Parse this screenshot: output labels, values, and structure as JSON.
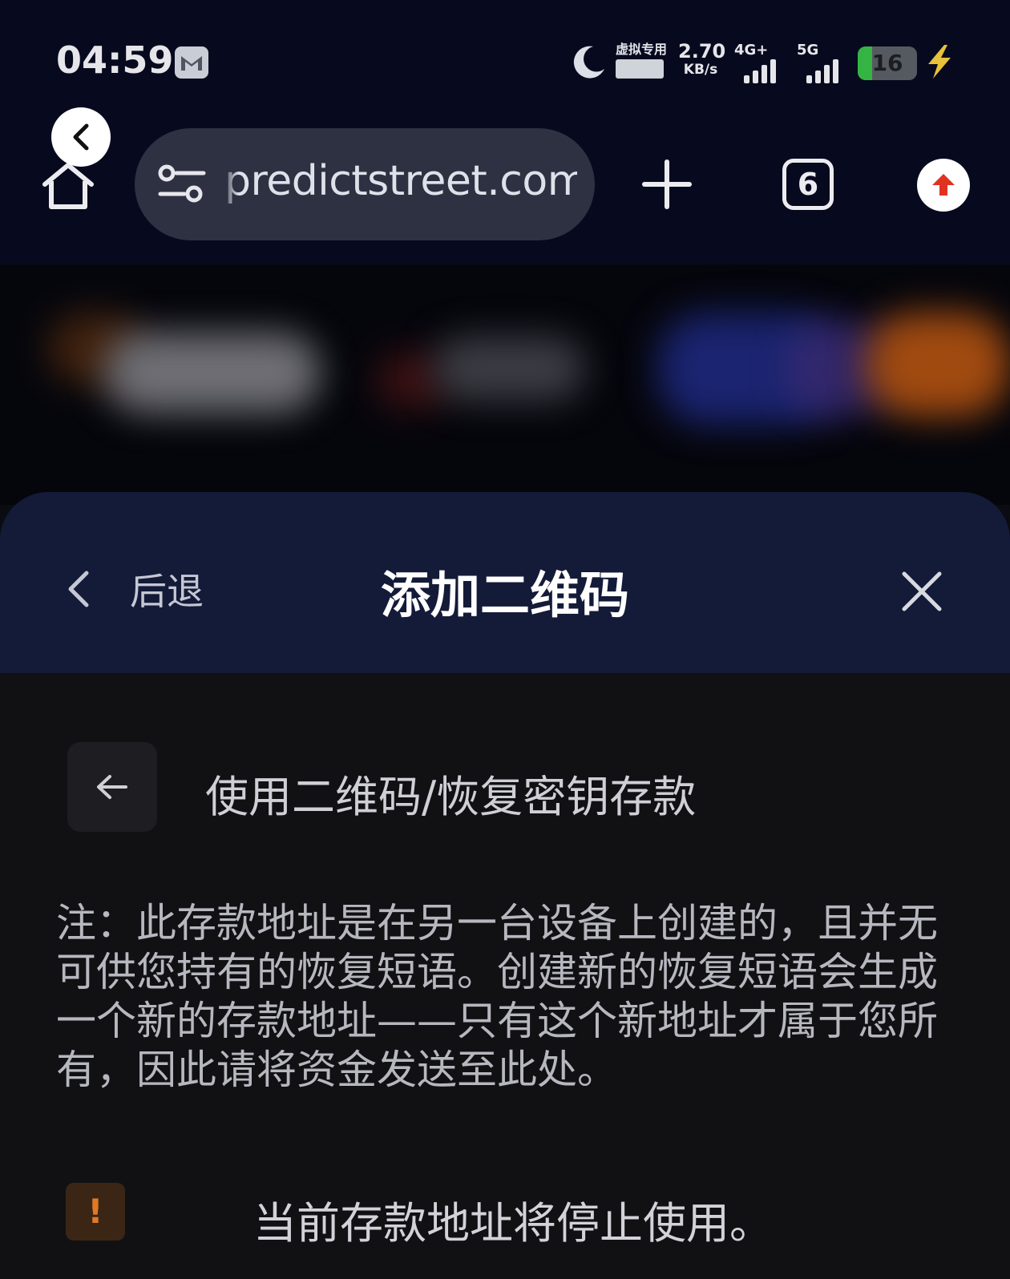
{
  "status_bar": {
    "time": "04:59",
    "virtual_network_label": "虚拟专用网络",
    "net_speed_value": "2.70",
    "net_speed_unit": "KB/s",
    "signal_1_label": "4G+",
    "signal_2_label": "5G",
    "battery_level": "16"
  },
  "browser": {
    "url": "predictstreet.com",
    "tab_count": "6"
  },
  "sheet": {
    "back_label": "后退",
    "title": "添加二维码",
    "subtitle": "使用二维码/恢复密钥存款",
    "note": "注：此存款地址是在另一台设备上创建的，且并无可供您持有的恢复短语。创建新的恢复短语会生成一个新的存款地址——只有这个新地址才属于您所有，因此请将资金发送至此处。",
    "warning_icon_text": "!",
    "warning": "当前存款地址将停止使用。"
  },
  "colors": {
    "status_bg": "#070a1e",
    "sheet_header_bg": "#141b38",
    "sheet_body_bg": "#111114",
    "warning_accent": "#e07a28",
    "battery_green": "#34b543"
  },
  "icons": [
    "gmail-icon",
    "moon-icon",
    "bolt-icon",
    "back-icon",
    "home-icon",
    "tune-icon",
    "plus-icon",
    "tabs-icon",
    "menu-upload-icon",
    "chevron-left-icon",
    "close-icon",
    "arrow-left-icon",
    "warning-icon"
  ]
}
